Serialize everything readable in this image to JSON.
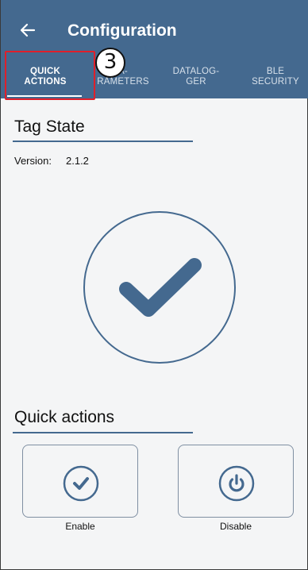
{
  "header": {
    "title": "Configuration",
    "back_icon": "arrow-left-icon"
  },
  "tabs": [
    {
      "label": "QUICK\nACTIONS",
      "active": true
    },
    {
      "label": "A-\nRAMETERS",
      "active": false
    },
    {
      "label": "DATALOG-\nGER",
      "active": false
    },
    {
      "label": "BLE\nSECURITY",
      "active": false
    }
  ],
  "annotation": {
    "badge": "3"
  },
  "tag_state": {
    "title": "Tag State",
    "version_label": "Version:",
    "version_value": "2.1.2",
    "status_icon": "check-icon"
  },
  "quick_actions": {
    "title": "Quick actions",
    "enable_label": "Enable",
    "enable_icon": "check-circle-icon",
    "disable_label": "Disable",
    "disable_icon": "power-icon"
  },
  "colors": {
    "primary": "#44698f",
    "highlight": "#e01f2a",
    "background": "#f4f5f6"
  }
}
